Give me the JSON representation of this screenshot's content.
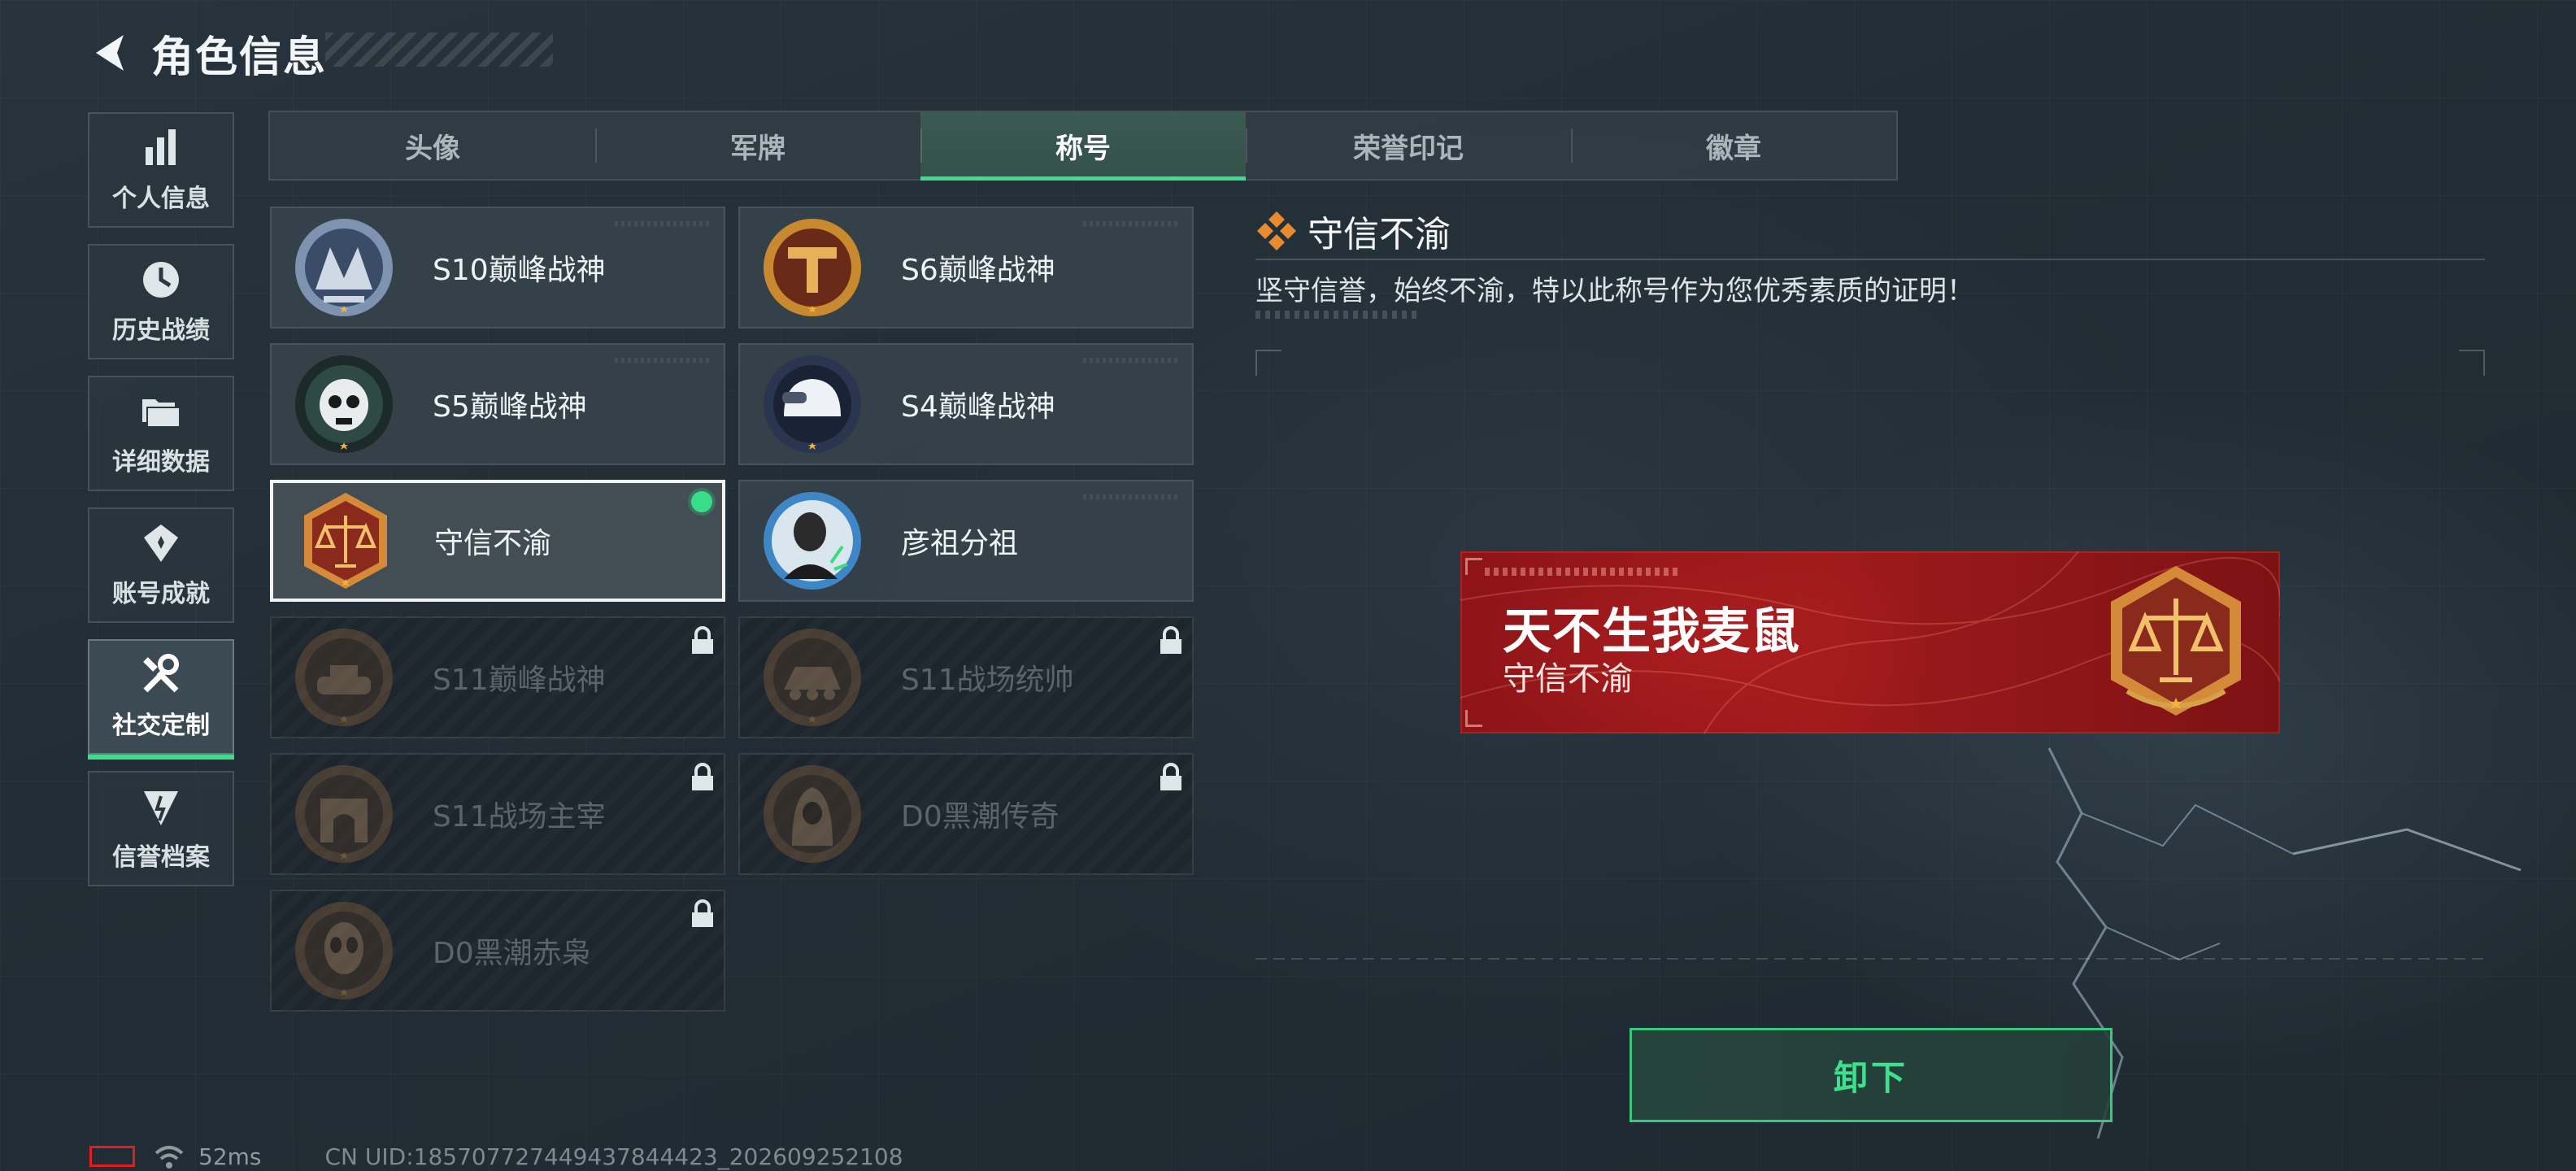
{
  "header": {
    "title": "角色信息"
  },
  "sidenav": {
    "items": [
      {
        "label": "个人信息",
        "icon": "bar-chart-icon",
        "active": false
      },
      {
        "label": "历史战绩",
        "icon": "clock-icon",
        "active": false
      },
      {
        "label": "详细数据",
        "icon": "folder-icon",
        "active": false
      },
      {
        "label": "账号成就",
        "icon": "achievement-icon",
        "active": false
      },
      {
        "label": "社交定制",
        "icon": "tools-icon",
        "active": true
      },
      {
        "label": "信誉档案",
        "icon": "credit-icon",
        "active": false
      }
    ]
  },
  "tabs": [
    {
      "label": "头像",
      "active": false
    },
    {
      "label": "军牌",
      "active": false
    },
    {
      "label": "称号",
      "active": true
    },
    {
      "label": "荣誉印记",
      "active": false
    },
    {
      "label": "徽章",
      "active": false
    }
  ],
  "titles": [
    {
      "name": "S10巅峰战神",
      "emblem": "s10-peak-emblem",
      "locked": false,
      "selected": false
    },
    {
      "name": "S6巅峰战神",
      "emblem": "s6-peak-emblem",
      "locked": false,
      "selected": false
    },
    {
      "name": "S5巅峰战神",
      "emblem": "s5-skull-emblem",
      "locked": false,
      "selected": false
    },
    {
      "name": "S4巅峰战神",
      "emblem": "s4-helmet-emblem",
      "locked": false,
      "selected": false
    },
    {
      "name": "守信不渝",
      "emblem": "scales-emblem",
      "locked": false,
      "selected": true
    },
    {
      "name": "彦祖分祖",
      "emblem": "portrait-emblem",
      "locked": false,
      "selected": false
    },
    {
      "name": "S11巅峰战神",
      "emblem": "tank-emblem",
      "locked": true,
      "selected": false
    },
    {
      "name": "S11战场统帅",
      "emblem": "apc-emblem",
      "locked": true,
      "selected": false
    },
    {
      "name": "S11战场主宰",
      "emblem": "arch-emblem",
      "locked": true,
      "selected": false
    },
    {
      "name": "D0黑潮传奇",
      "emblem": "hooded-emblem",
      "locked": true,
      "selected": false
    },
    {
      "name": "D0黑潮赤枭",
      "emblem": "alien-emblem",
      "locked": true,
      "selected": false
    }
  ],
  "detail": {
    "title": "守信不渝",
    "description": "坚守信誉，始终不渝，特以此称号作为您优秀素质的证明！"
  },
  "banner": {
    "player_name": "天不生我麦鼠",
    "title": "守信不渝",
    "color": "#9a181b"
  },
  "actions": {
    "unequip_label": "卸下"
  },
  "status": {
    "ping": "52ms",
    "uid": "CN UID:185707727449437844423_202609252108"
  },
  "colors": {
    "accent": "#3fdc8e",
    "banner": "#9a181b",
    "battery_low": "#e02020"
  }
}
